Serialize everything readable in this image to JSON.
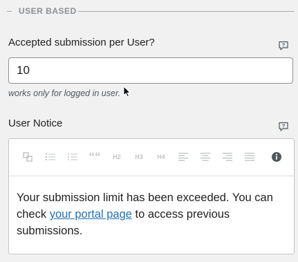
{
  "section": {
    "title": "USER BASED"
  },
  "limit_field": {
    "label": "Accepted submission per User?",
    "value": "10",
    "hint": "works only for logged in user."
  },
  "notice_field": {
    "label": "User Notice",
    "toolbar": {
      "blockquote_label": "““",
      "h2_label": "H2",
      "h3_label": "H3",
      "h4_label": "H4"
    },
    "content": {
      "before_link": "Your submission limit has been exceeded. You can check ",
      "link_text": "your portal page",
      "after_link": " to access previous submissions."
    }
  },
  "icons": {
    "help": "help-bubble-icon",
    "info": "info-circle-icon"
  },
  "colors": {
    "link": "#2271b1",
    "background": "#f1f1f1",
    "toolbar_disabled": "#c3c4c7",
    "info_icon": "#50575e"
  }
}
